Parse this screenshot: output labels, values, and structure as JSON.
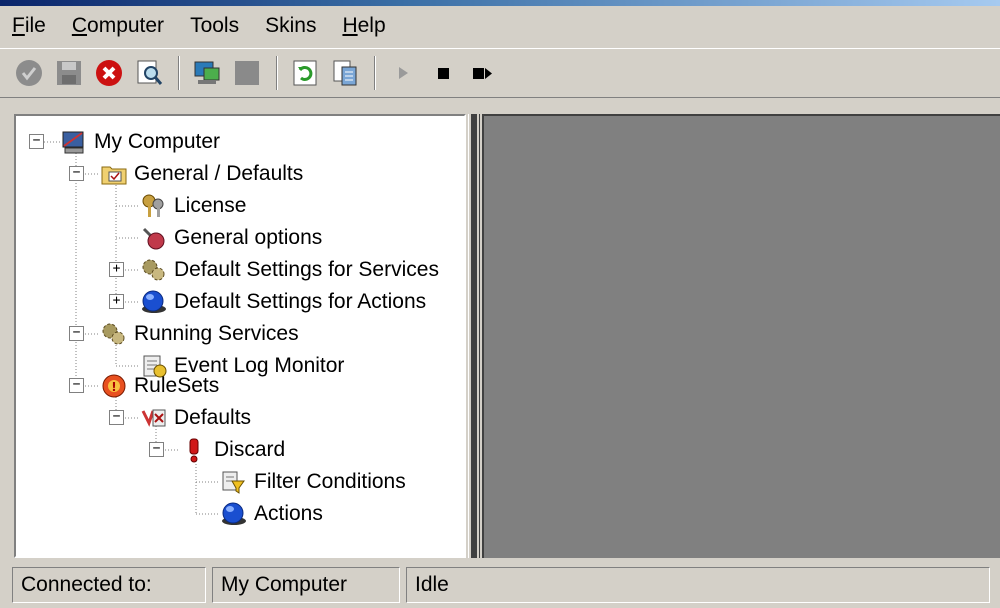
{
  "menubar": {
    "items": [
      {
        "pre": "",
        "u": "F",
        "post": "ile"
      },
      {
        "pre": "",
        "u": "C",
        "post": "omputer"
      },
      {
        "pre": "Tools",
        "u": "",
        "post": ""
      },
      {
        "pre": "Skins",
        "u": "",
        "post": ""
      },
      {
        "pre": "",
        "u": "H",
        "post": "elp"
      }
    ]
  },
  "toolbar": {
    "buttons": [
      "check-icon",
      "save-icon",
      "cancel-icon",
      "search-icon",
      "connect-icon",
      "disconnect-icon",
      "refresh-icon",
      "properties-icon",
      "play-icon",
      "stop-icon",
      "step-icon"
    ]
  },
  "tree": {
    "my_computer": "My Computer",
    "general_defaults": "General / Defaults",
    "license": "License",
    "general_options": "General options",
    "default_services": "Default Settings for Services",
    "default_actions": "Default Settings for Actions",
    "running_services": "Running Services",
    "event_log_monitor": "Event Log Monitor",
    "rulesets": "RuleSets",
    "defaults": "Defaults",
    "discard": "Discard",
    "filter_conditions": "Filter Conditions",
    "actions": "Actions"
  },
  "status": {
    "connected_label": "Connected to:",
    "computer": "My Computer",
    "state": "Idle"
  }
}
